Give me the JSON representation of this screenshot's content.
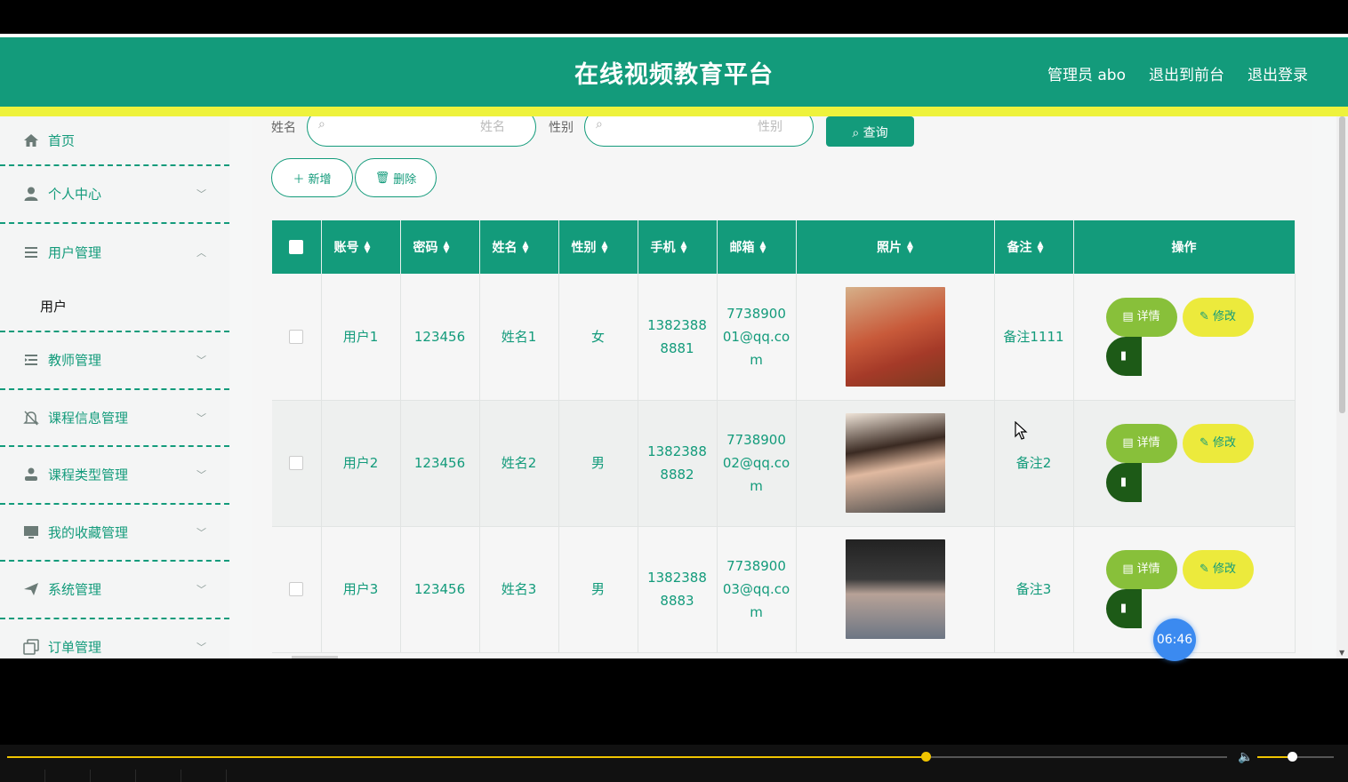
{
  "header": {
    "title": "在线视频教育平台",
    "admin": "管理员 abo",
    "back_front": "退出到前台",
    "logout": "退出登录"
  },
  "sidebar": {
    "items": [
      {
        "label": "首页",
        "icon": "home-icon"
      },
      {
        "label": "个人中心",
        "icon": "user-icon"
      },
      {
        "label": "用户管理",
        "icon": "list-icon",
        "expanded": true,
        "sub": "用户"
      },
      {
        "label": "教师管理",
        "icon": "list-indent-icon"
      },
      {
        "label": "课程信息管理",
        "icon": "bell-off-icon"
      },
      {
        "label": "课程类型管理",
        "icon": "user-solid-icon"
      },
      {
        "label": "我的收藏管理",
        "icon": "monitor-icon"
      },
      {
        "label": "系统管理",
        "icon": "send-icon"
      },
      {
        "label": "订单管理",
        "icon": "copy-icon"
      }
    ]
  },
  "search": {
    "name_label": "姓名",
    "name_placeholder": "姓名",
    "gender_label": "性别",
    "gender_placeholder": "性别",
    "query_button": "查询"
  },
  "actions": {
    "add": "新增",
    "delete": "删除"
  },
  "table": {
    "headers": [
      "账号",
      "密码",
      "姓名",
      "性别",
      "手机",
      "邮箱",
      "照片",
      "备注",
      "操作"
    ],
    "rows": [
      {
        "account": "用户1",
        "password": "123456",
        "name": "姓名1",
        "gender": "女",
        "phone": "13823888881",
        "email": "773890001@qq.com",
        "note": "备注1111"
      },
      {
        "account": "用户2",
        "password": "123456",
        "name": "姓名2",
        "gender": "男",
        "phone": "13823888882",
        "email": "773890002@qq.com",
        "note": "备注2"
      },
      {
        "account": "用户3",
        "password": "123456",
        "name": "姓名3",
        "gender": "男",
        "phone": "13823888883",
        "email": "773890003@qq.com",
        "note": "备注3"
      }
    ],
    "row_actions": {
      "detail": "详情",
      "edit": "修改"
    }
  },
  "overlay": {
    "timer": "06:46"
  },
  "player": {
    "progress": 0.753,
    "volume": 0.45
  },
  "colors": {
    "primary": "#139b7b",
    "accent_yellow": "#eef23c",
    "detail_green": "#88c03a",
    "delete_dark": "#1d5a17"
  }
}
